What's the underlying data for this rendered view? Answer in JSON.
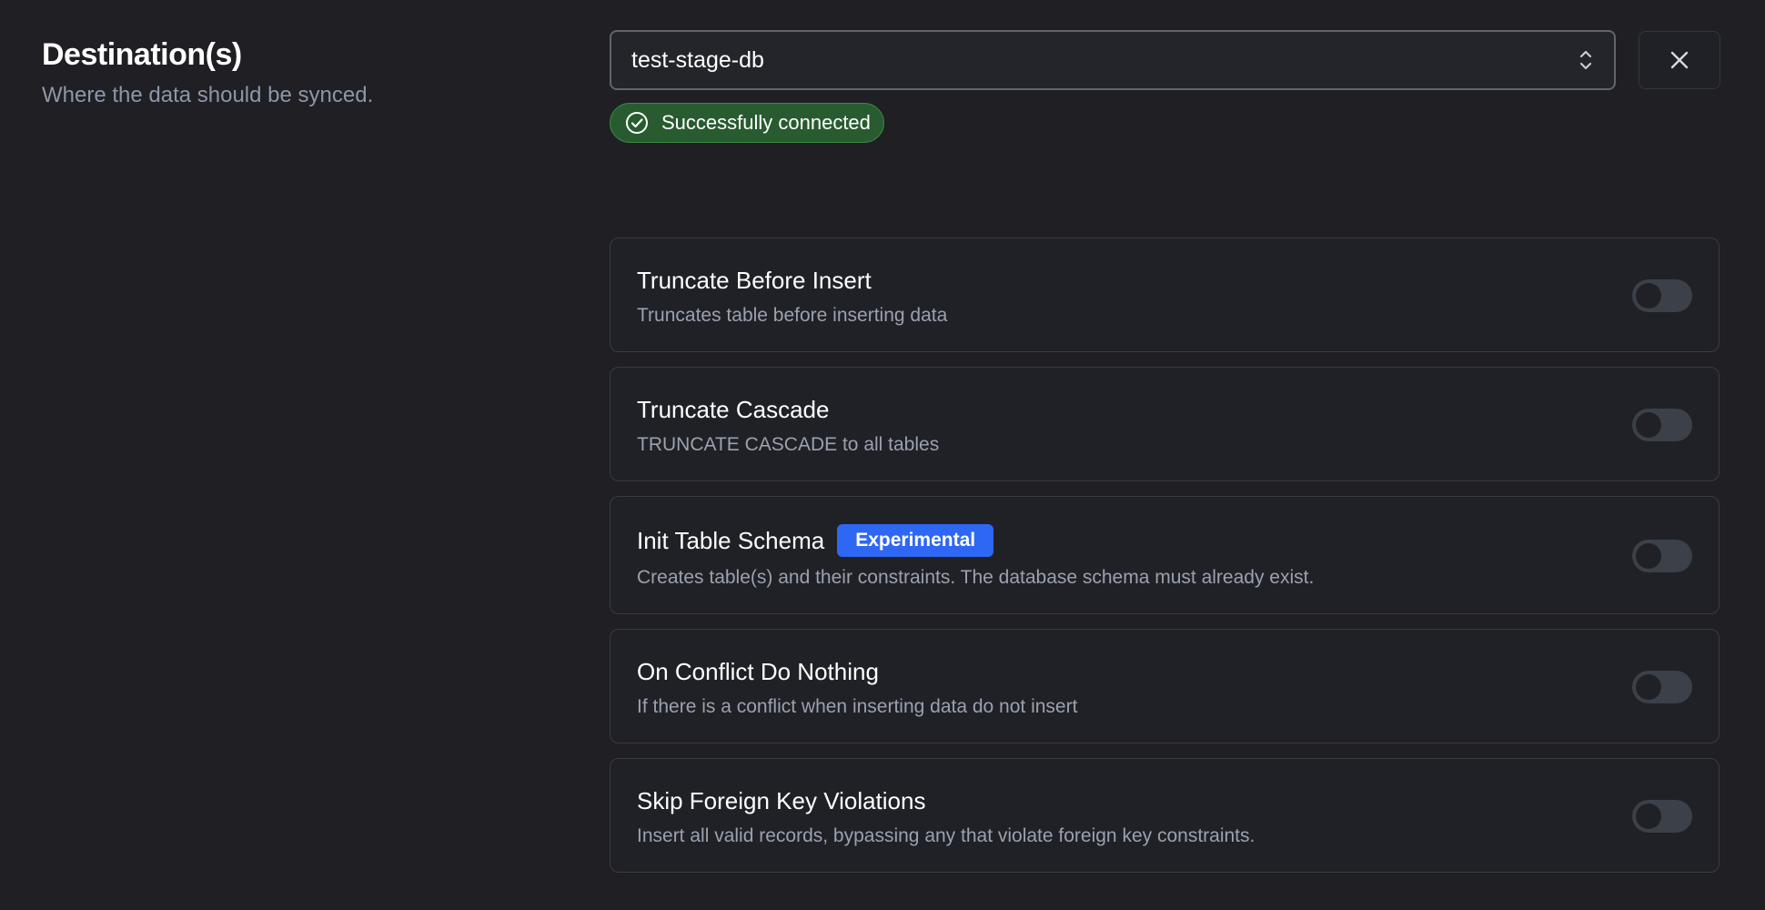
{
  "section": {
    "title": "Destination(s)",
    "subtitle": "Where the data should be synced."
  },
  "destination": {
    "selected_value": "test-stage-db",
    "status_text": "Successfully connected",
    "status_color": "#295b31"
  },
  "settings": [
    {
      "title": "Truncate Before Insert",
      "description": "Truncates table before inserting data",
      "enabled": false
    },
    {
      "title": "Truncate Cascade",
      "description": "TRUNCATE CASCADE to all tables",
      "enabled": false
    },
    {
      "title": "Init Table Schema",
      "badge": "Experimental",
      "description": "Creates table(s) and their constraints. The database schema must already exist.",
      "enabled": false
    },
    {
      "title": "On Conflict Do Nothing",
      "description": "If there is a conflict when inserting data do not insert",
      "enabled": false
    },
    {
      "title": "Skip Foreign Key Violations",
      "description": "Insert all valid records, bypassing any that violate foreign key constraints.",
      "enabled": false
    }
  ],
  "icons": {
    "selector": "chevron-up-down-icon",
    "close": "close-icon",
    "status": "check-circle-icon"
  },
  "colors": {
    "background": "#1f1f24",
    "accent_badge": "#2f67f5",
    "toggle_off": "#3b4049"
  }
}
